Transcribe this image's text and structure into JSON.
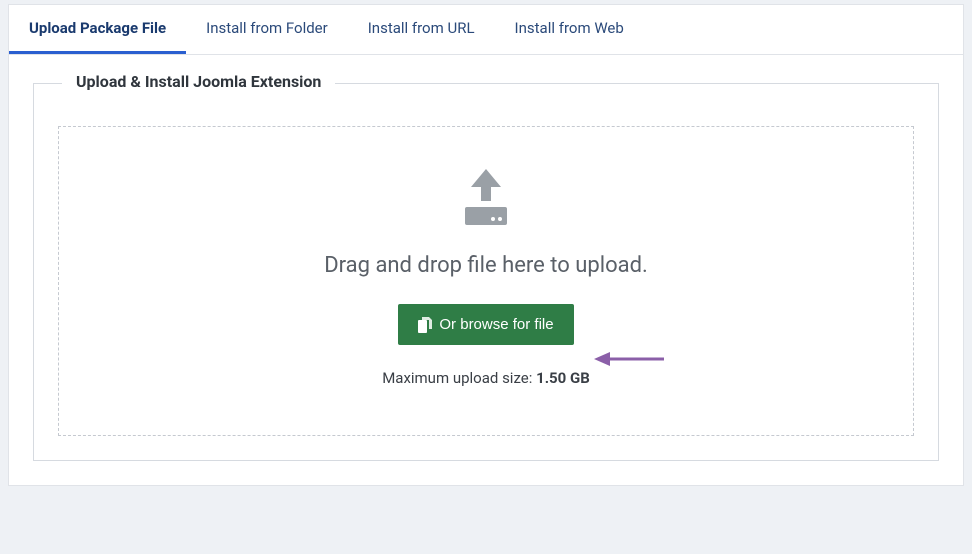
{
  "tabs": [
    {
      "label": "Upload Package File"
    },
    {
      "label": "Install from Folder"
    },
    {
      "label": "Install from URL"
    },
    {
      "label": "Install from Web"
    }
  ],
  "fieldset": {
    "legend": "Upload & Install Joomla Extension"
  },
  "dropzone": {
    "drag_text": "Drag and drop file here to upload.",
    "browse_label": "Or browse for file",
    "max_upload_label": "Maximum upload size: ",
    "max_upload_value": "1.50 GB"
  }
}
